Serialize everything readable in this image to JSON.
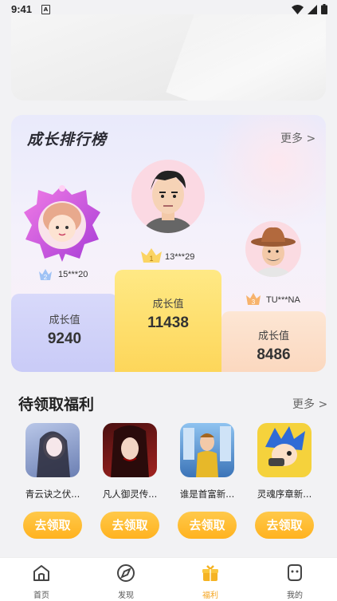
{
  "status_bar": {
    "time": "9:41",
    "notification_letter": "A"
  },
  "ranking": {
    "title": "成长排行榜",
    "more": "更多 >",
    "first": {
      "rank": "1",
      "user": "13***29",
      "label": "成长值",
      "value": "11438"
    },
    "second": {
      "rank": "2",
      "user": "15***20",
      "label": "成长值",
      "value": "9240"
    },
    "third": {
      "rank": "3",
      "user": "TU***NA",
      "label": "成长值",
      "value": "8486"
    }
  },
  "welfare": {
    "title": "待领取福利",
    "more": "更多 >",
    "games": [
      {
        "name": "青云诀之伏...",
        "button": "去领取"
      },
      {
        "name": "凡人御灵传...",
        "button": "去领取"
      },
      {
        "name": "谁是首富新...",
        "button": "去领取"
      },
      {
        "name": "灵魂序章新...",
        "button": "去领取"
      }
    ]
  },
  "tabbar": {
    "tabs": [
      {
        "label": "首页",
        "icon": "home-icon"
      },
      {
        "label": "发现",
        "icon": "discover-icon"
      },
      {
        "label": "福利",
        "icon": "gift-icon",
        "active": true
      },
      {
        "label": "我的",
        "icon": "profile-icon"
      }
    ]
  },
  "colors": {
    "accent": "#ffb21f",
    "active_tab": "#f5a623"
  }
}
